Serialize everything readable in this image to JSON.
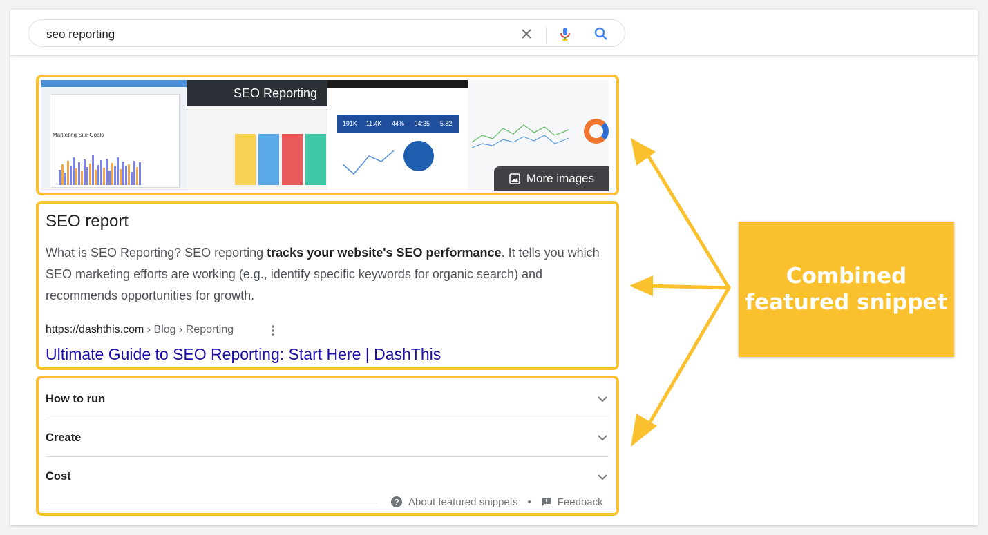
{
  "search": {
    "query": "seo reporting"
  },
  "images": {
    "more_label": "More images",
    "thumb2_title": "SEO Reporting",
    "thumb1_heading": "Marketing Site Goals",
    "thumb3_kpis": [
      "191K",
      "11.4K",
      "44%",
      "04:35",
      "5.82"
    ]
  },
  "snippet": {
    "title": "SEO report",
    "body_pre": "What is SEO Reporting? SEO reporting ",
    "body_bold": "tracks your website's SEO performance",
    "body_post": ". It tells you which SEO marketing efforts are working (e.g., identify specific keywords for organic search) and recommends opportunities for growth.",
    "cite_domain": "https://dashthis.com",
    "cite_path": " › Blog › Reporting",
    "link_title": "Ultimate Guide to SEO Reporting: Start Here | DashThis"
  },
  "accordion": [
    {
      "label": "How to run"
    },
    {
      "label": "Create"
    },
    {
      "label": "Cost"
    }
  ],
  "footer": {
    "about": "About featured snippets",
    "separator": "•",
    "feedback": "Feedback"
  },
  "callout": {
    "line1": "Combined",
    "line2": "featured snippet"
  },
  "colors": {
    "accent": "#fbc02d",
    "link": "#1a0dab",
    "text": "#202124",
    "muted": "#4d5156"
  }
}
